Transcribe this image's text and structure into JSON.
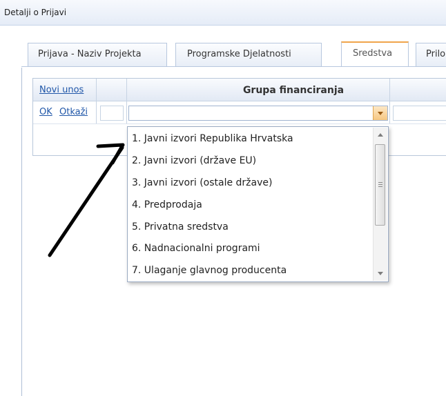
{
  "panel": {
    "title": "Detalji o Prijavi"
  },
  "tabs": [
    {
      "label": "Prijava - Naziv Projekta",
      "active": false
    },
    {
      "label": "Programske Djelatnosti",
      "active": false
    },
    {
      "label": "Sredstva",
      "active": true
    },
    {
      "label": "Prilo",
      "active": false
    }
  ],
  "grid": {
    "new_entry_link": "Novi unos",
    "column_header": "Grupa financiranja",
    "ok_link": "OK",
    "cancel_link": "Otkaži",
    "combo_value": ""
  },
  "dropdown": {
    "options": [
      "1. Javni izvori Republika Hrvatska",
      "2. Javni izvori (države EU)",
      "3. Javni izvori (ostale države)",
      "4. Predprodaja",
      "5. Privatna sredstva",
      "6. Nadnacionalni programi",
      "7. Ulaganje glavnog producenta"
    ]
  },
  "colors": {
    "accent": "#f0a44a",
    "link": "#1f56a8",
    "border": "#b7c7de"
  },
  "annotation": {
    "icon": "hand-drawn-arrow-icon"
  }
}
